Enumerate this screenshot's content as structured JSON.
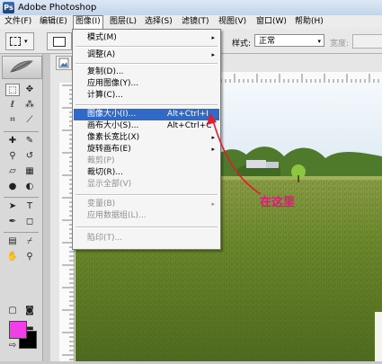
{
  "window": {
    "title": "Adobe Photoshop",
    "app_icon": "Ps"
  },
  "menubar": [
    {
      "label": "文件(F)"
    },
    {
      "label": "编辑(E)"
    },
    {
      "label": "图像(I)",
      "active": true
    },
    {
      "label": "图层(L)"
    },
    {
      "label": "选择(S)"
    },
    {
      "label": "滤镜(T)"
    },
    {
      "label": "视图(V)"
    },
    {
      "label": "窗口(W)"
    },
    {
      "label": "帮助(H)"
    }
  ],
  "options_bar": {
    "style_label": "样式:",
    "style_value": "正常",
    "width_label": "宽度:"
  },
  "image_menu": {
    "items": [
      {
        "label": "模式(M)",
        "submenu": true
      },
      {
        "separator": true
      },
      {
        "label": "调整(A)",
        "submenu": true
      },
      {
        "separator": true
      },
      {
        "label": "复制(D)..."
      },
      {
        "label": "应用图像(Y)..."
      },
      {
        "label": "计算(C)..."
      },
      {
        "separator": true
      },
      {
        "label": "图像大小(I)...",
        "shortcut": "Alt+Ctrl+I",
        "highlighted": true
      },
      {
        "label": "画布大小(S)...",
        "shortcut": "Alt+Ctrl+C"
      },
      {
        "label": "像素长宽比(X)",
        "submenu": true
      },
      {
        "label": "旋转画布(E)",
        "submenu": true
      },
      {
        "label": "裁剪(P)",
        "disabled": true
      },
      {
        "label": "裁切(R)..."
      },
      {
        "label": "显示全部(V)",
        "disabled": true
      },
      {
        "separator": true
      },
      {
        "label": "变量(B)",
        "submenu": true,
        "disabled": true
      },
      {
        "label": "应用数据组(L)...",
        "disabled": true
      },
      {
        "separator": true
      },
      {
        "label": "陷印(T)...",
        "disabled": true
      }
    ]
  },
  "annotation": {
    "text": "在这里",
    "color": "#e4157e"
  },
  "colors": {
    "foreground": "#f23ee8",
    "background": "#000000",
    "menu_highlight": "#3169c6",
    "arrow": "#e01c2e"
  },
  "icons": {
    "submenu": "▸",
    "dropdown": "▾"
  }
}
